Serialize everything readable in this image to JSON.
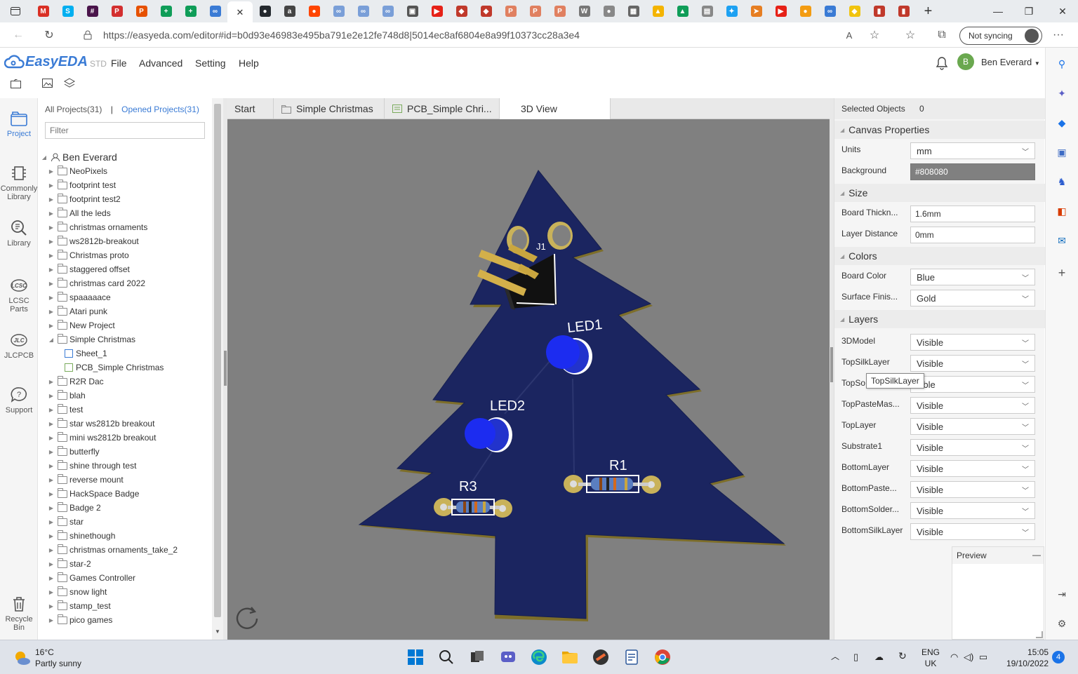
{
  "browser": {
    "url": "https://easyeda.com/editor#id=b0d93e46983e495ba791e2e12fe748d8|5014ec8af6804e8a99f10373cc28a3e4",
    "sync_label": "Not syncing",
    "tab_close": "✕",
    "tab_favicons": [
      {
        "icon": "gmail-icon",
        "color": "#d93025",
        "glyph": "M"
      },
      {
        "icon": "skype-icon",
        "color": "#00aff0",
        "glyph": "S"
      },
      {
        "icon": "slack-icon",
        "color": "#4a154b",
        "glyph": "#"
      },
      {
        "icon": "pdf-icon",
        "color": "#d32f2f",
        "glyph": "P"
      },
      {
        "icon": "pdf-icon",
        "color": "#e65100",
        "glyph": "P"
      },
      {
        "icon": "sheets-icon",
        "color": "#0f9d58",
        "glyph": "+"
      },
      {
        "icon": "sheets-icon",
        "color": "#0f9d58",
        "glyph": "+"
      },
      {
        "icon": "easyeda-icon",
        "color": "#3a7bd5",
        "glyph": "∞"
      }
    ],
    "tab_favicons_right": [
      {
        "icon": "github-icon",
        "color": "#24292e",
        "glyph": "●"
      },
      {
        "icon": "amazon-icon",
        "color": "#444",
        "glyph": "a"
      },
      {
        "icon": "reddit-icon",
        "color": "#ff4500",
        "glyph": "●"
      },
      {
        "icon": "easyeda-icon",
        "color": "#7a9fd8",
        "glyph": "∞"
      },
      {
        "icon": "easyeda-icon",
        "color": "#7a9fd8",
        "glyph": "∞"
      },
      {
        "icon": "easyeda-icon",
        "color": "#7a9fd8",
        "glyph": "∞"
      },
      {
        "icon": "app-icon",
        "color": "#555",
        "glyph": "▣"
      },
      {
        "icon": "youtube-icon",
        "color": "#e62117",
        "glyph": "▶"
      },
      {
        "icon": "app-icon",
        "color": "#c0392b",
        "glyph": "◆"
      },
      {
        "icon": "app-icon",
        "color": "#c0392b",
        "glyph": "◆"
      },
      {
        "icon": "pdf-icon",
        "color": "#e08060",
        "glyph": "P"
      },
      {
        "icon": "pdf-icon",
        "color": "#e08060",
        "glyph": "P"
      },
      {
        "icon": "pdf-icon",
        "color": "#e08060",
        "glyph": "P"
      },
      {
        "icon": "wikipedia-icon",
        "color": "#777",
        "glyph": "W"
      },
      {
        "icon": "app-icon",
        "color": "#888",
        "glyph": "●"
      },
      {
        "icon": "app-icon",
        "color": "#666",
        "glyph": "▦"
      },
      {
        "icon": "drive-icon",
        "color": "#f4b400",
        "glyph": "▲"
      },
      {
        "icon": "drive-icon",
        "color": "#0f9d58",
        "glyph": "▲"
      },
      {
        "icon": "app-icon",
        "color": "#888",
        "glyph": "▤"
      },
      {
        "icon": "twitter-icon",
        "color": "#1da1f2",
        "glyph": "✦"
      },
      {
        "icon": "app-icon",
        "color": "#e67e22",
        "glyph": "➤"
      },
      {
        "icon": "youtube-icon",
        "color": "#e62117",
        "glyph": "▶"
      },
      {
        "icon": "app-icon",
        "color": "#f39c12",
        "glyph": "●"
      },
      {
        "icon": "easyeda-icon",
        "color": "#3a7bd5",
        "glyph": "∞"
      },
      {
        "icon": "app-icon",
        "color": "#f1c40f",
        "glyph": "◆"
      },
      {
        "icon": "app-icon",
        "color": "#c0392b",
        "glyph": "▮"
      },
      {
        "icon": "app-icon",
        "color": "#c0392b",
        "glyph": "▮"
      }
    ]
  },
  "app": {
    "logo": "EasyEDA",
    "edition": "STD",
    "menu": [
      "File",
      "Advanced",
      "Setting",
      "Help"
    ],
    "user_initial": "B",
    "user_name": "Ben Everard",
    "accent": "#3a7bd5"
  },
  "rail": [
    {
      "label": "Project",
      "icon": "project-icon"
    },
    {
      "label": "Commonly Library",
      "icon": "chip-icon"
    },
    {
      "label": "Library",
      "icon": "search-library-icon"
    },
    {
      "label": "LCSC Parts",
      "icon": "lcsc-icon"
    },
    {
      "label": "JLCPCB",
      "icon": "jlc-icon"
    },
    {
      "label": "Support",
      "icon": "support-icon"
    },
    {
      "label": "Recycle Bin",
      "icon": "trash-icon"
    }
  ],
  "projects": {
    "all_label": "All Projects(31)",
    "separator": "|",
    "opened_label": "Opened Projects(31)",
    "filter_placeholder": "Filter",
    "owner": "Ben Everard",
    "items": [
      "NeoPixels",
      "footprint test",
      "footprint test2",
      "All the leds",
      "christmas ornaments",
      "ws2812b-breakout",
      "Christmas proto",
      "staggered offset",
      "christmas card 2022",
      "spaaaaace",
      "Atari punk",
      "New Project",
      "Simple Christmas"
    ],
    "children": [
      "Sheet_1",
      "PCB_Simple Christmas"
    ],
    "items_after": [
      "R2R Dac",
      "blah",
      "test",
      "star ws2812b breakout",
      "mini ws2812b breakout",
      "butterfly",
      "shine through test",
      "reverse mount",
      "HackSpace Badge",
      "Badge 2",
      "star",
      "shinethough",
      "christmas ornaments_take_2",
      "star-2",
      "Games Controller",
      "snow light",
      "stamp_test",
      "pico games"
    ]
  },
  "doctabs": [
    "Start",
    "Simple Christmas",
    "PCB_Simple Chri...",
    "3D View"
  ],
  "canvas": {
    "labels": {
      "j1": "J1",
      "led1": "LED1",
      "led2": "LED2",
      "r1": "R1",
      "r3": "R3"
    },
    "board_color": "#1b2560"
  },
  "props": {
    "selected_label": "Selected Objects",
    "selected_count": "0",
    "sections": {
      "canvas": "Canvas Properties",
      "size": "Size",
      "colors": "Colors",
      "layers": "Layers"
    },
    "units_label": "Units",
    "units_value": "mm",
    "background_label": "Background",
    "background_value": "#808080",
    "thickness_label": "Board Thickn...",
    "thickness_value": "1.6mm",
    "layer_distance_label": "Layer Distance",
    "layer_distance_value": "0mm",
    "board_color_label": "Board Color",
    "board_color_value": "Blue",
    "surface_label": "Surface Finis...",
    "surface_value": "Gold",
    "layers": [
      {
        "name": "3DModel",
        "value": "Visible"
      },
      {
        "name": "TopSilkLayer",
        "value": "Visible"
      },
      {
        "name": "TopSo",
        "value": "sible"
      },
      {
        "name": "TopPasteMas...",
        "value": "Visible"
      },
      {
        "name": "TopLayer",
        "value": "Visible"
      },
      {
        "name": "Substrate1",
        "value": "Visible"
      },
      {
        "name": "BottomLayer",
        "value": "Visible"
      },
      {
        "name": "BottomPaste...",
        "value": "Visible"
      },
      {
        "name": "BottomSolder...",
        "value": "Visible"
      },
      {
        "name": "BottomSilkLayer",
        "value": "Visible"
      }
    ],
    "tooltip": "TopSilkLayer",
    "preview_label": "Preview",
    "preview_collapse": "—"
  },
  "taskbar": {
    "temp": "16°C",
    "weather": "Partly sunny",
    "lang_top": "ENG",
    "lang_bottom": "UK",
    "time": "15:05",
    "date": "19/10/2022",
    "notifications": "4"
  }
}
